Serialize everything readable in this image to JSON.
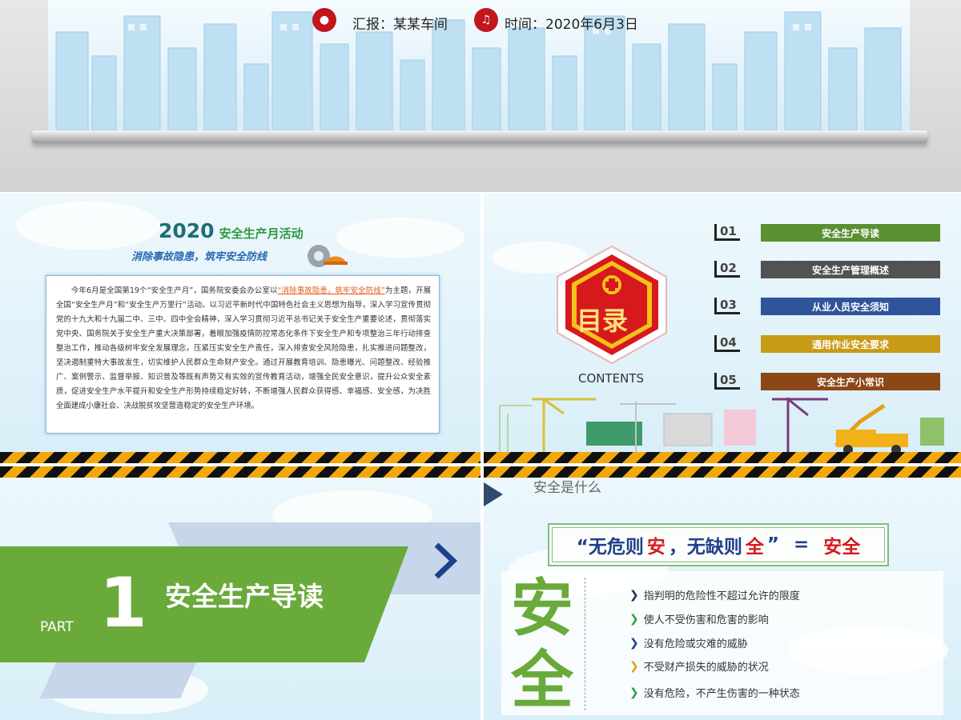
{
  "banner": {
    "reporter": "汇报：某某车间",
    "time": "时间：2020年6月3日"
  },
  "slide1": {
    "year": "2020",
    "title": "安全生产月活动",
    "subtitle": "消除事故隐患，筑牢安全防线",
    "para_before": "今年6月是全国第19个“安全生产月”，国务院安委会办公室以",
    "para_highlight": "“消除事故隐患，筑牢安全防线”",
    "para_after": "为主题，开展全国“安全生产月”和“安全生产万里行”活动。以习近平新时代中国特色社会主义思想为指导，深入学习宣传贯彻党的十九大和十九届二中、三中、四中全会精神，深入学习贯彻习近平总书记关于安全生产重要论述，贯彻落实党中央、国务院关于安全生产重大决策部署，着眼加强疫情防控常态化条件下安全生产和专项整治三年行动排查整治工作，推动各级树牢安全发展理念，压紧压实安全生产责任，深入排查安全风险隐患，扎实推进问题整改，坚决遏制重特大事故发生，切实维护人民群众生命财产安全。通过开展教育培训、隐患曝光、问题整改、经验推广、案例警示、监督举报、知识普及等既有声势又有实效的宣传教育活动，增强全民安全意识，提升公众安全素质，促进安全生产水平提升和安全生产形势持续稳定好转，不断增强人民群众获得感、幸福感、安全感，为决胜全面建成小康社会、决战脱贫攻坚营造稳定的安全生产环境。"
  },
  "slide2": {
    "badge": "目录",
    "contents_label": "CONTENTS",
    "items": [
      {
        "num": "01",
        "label": "安全生产导读",
        "color": "#5a8f32"
      },
      {
        "num": "02",
        "label": "安全生产管理概述",
        "color": "#525252"
      },
      {
        "num": "03",
        "label": "从业人员安全须知",
        "color": "#2f549c"
      },
      {
        "num": "04",
        "label": "通用作业安全要求",
        "color": "#c89b16"
      },
      {
        "num": "05",
        "label": "安全生产小常识",
        "color": "#8b4716"
      }
    ]
  },
  "slide3": {
    "part": "PART",
    "number": "1",
    "title": "安全生产导读"
  },
  "slide4": {
    "heading": "安全是什么",
    "f_q1": "“无危则",
    "f_r1": "安",
    "f_mid": "，无缺则",
    "f_r2": "全",
    "f_q2": "”",
    "f_eq": "=",
    "f_ans": "安全",
    "big_chars": [
      "安",
      "全"
    ],
    "bullets": [
      {
        "text": "指判明的危险性不超过允许的限度",
        "color": "#1f2d5a"
      },
      {
        "text": "使人不受伤害和危害的影响",
        "color": "#27a14a"
      },
      {
        "text": "没有危险或灾难的威胁",
        "color": "#1f3f8a"
      },
      {
        "text": "不受财产损失的威胁的状况",
        "color": "#e0a010"
      },
      {
        "text": "没有危险，不产生伤害的一种状态",
        "color": "#27a14a"
      }
    ]
  }
}
